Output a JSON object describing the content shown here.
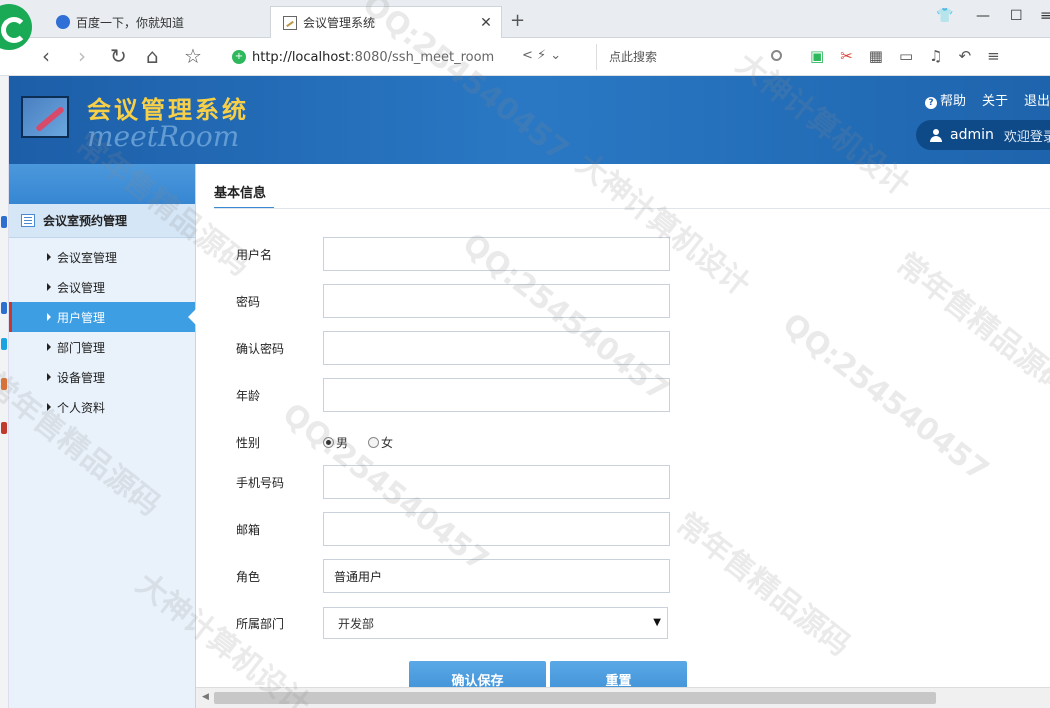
{
  "browser": {
    "tabs": [
      {
        "title": "百度一下，你就知道",
        "active": false
      },
      {
        "title": "会议管理系统",
        "active": true
      }
    ],
    "url_host": "http://localhost",
    "url_rest": ":8080/ssh_meet_room",
    "search_placeholder": "点此搜索"
  },
  "header": {
    "title": "会议管理系统",
    "subtitle": "meetRoom",
    "help_label": "帮助",
    "about_label": "关于",
    "logout_label": "退出",
    "username": "admin",
    "welcome": "欢迎登录"
  },
  "sidebar": {
    "group_title": "会议室预约管理",
    "items": [
      {
        "label": "会议室管理",
        "active": false
      },
      {
        "label": "会议管理",
        "active": false
      },
      {
        "label": "用户管理",
        "active": true
      },
      {
        "label": "部门管理",
        "active": false
      },
      {
        "label": "设备管理",
        "active": false
      },
      {
        "label": "个人资料",
        "active": false
      }
    ]
  },
  "form": {
    "section_title": "基本信息",
    "fields": {
      "username": {
        "label": "用户名",
        "value": ""
      },
      "password": {
        "label": "密码",
        "value": ""
      },
      "confirm_password": {
        "label": "确认密码",
        "value": ""
      },
      "age": {
        "label": "年龄",
        "value": ""
      },
      "gender": {
        "label": "性别",
        "options": [
          "男",
          "女"
        ],
        "selected": "男"
      },
      "phone": {
        "label": "手机号码",
        "value": ""
      },
      "email": {
        "label": "邮箱",
        "value": ""
      },
      "role": {
        "label": "角色",
        "value": "普通用户"
      },
      "department": {
        "label": "所属部门",
        "selected": "开发部"
      }
    },
    "save_label": "确认保存",
    "reset_label": "重置"
  },
  "watermarks": {
    "qq": "QQ:254540457",
    "seller": "常年售精品源码",
    "design": "大神计算机设计"
  },
  "colors": {
    "header_blue": "#2a78c4",
    "title_gold": "#f7d048",
    "active_menu": "#3d9ee4",
    "button_blue": "#4a9bdd"
  }
}
